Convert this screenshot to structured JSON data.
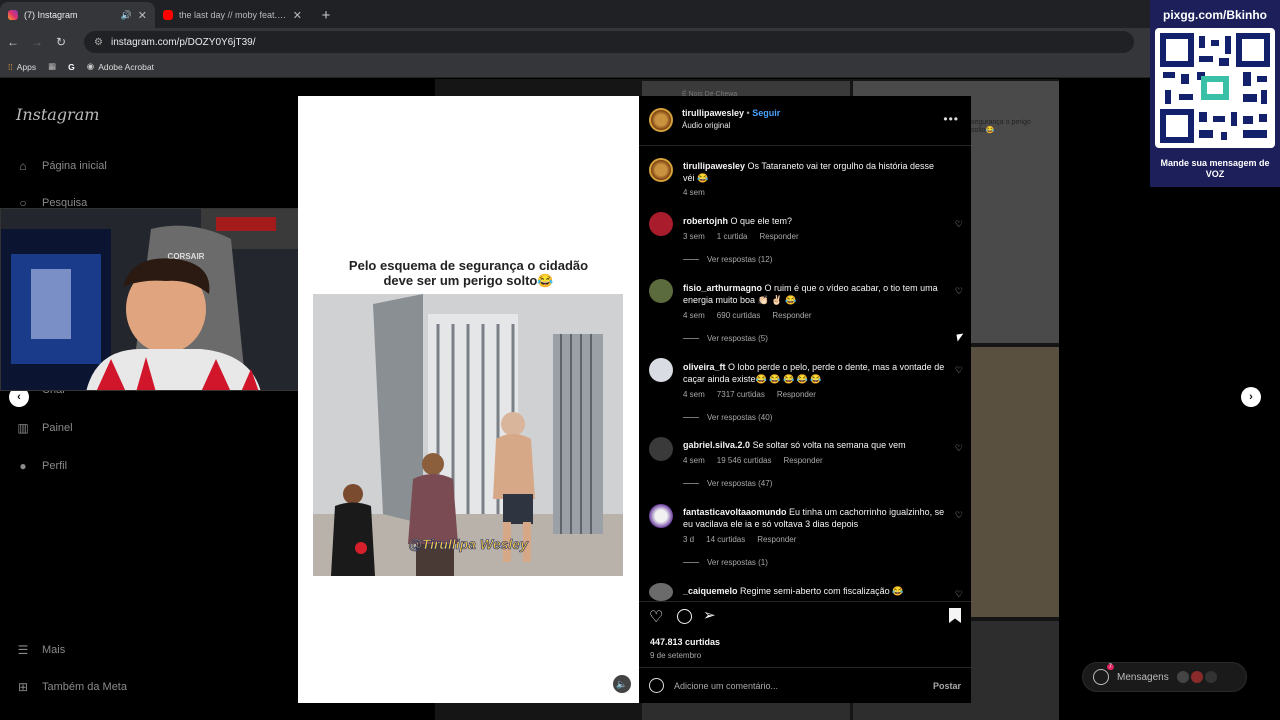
{
  "browser": {
    "tabs": [
      {
        "title": "(7) Instagram",
        "active": true,
        "favicon_color": "#e1306c"
      },
      {
        "title": "the last day // moby feat. skylar",
        "active": false,
        "favicon_color": "#ff0000"
      }
    ],
    "url": "instagram.com/p/DOZY0Y6jT39/",
    "bookmarks": [
      "Apps",
      "Adobe Acrobat"
    ]
  },
  "sidebar": {
    "logo": "Instagram",
    "items": [
      {
        "label": "Página inicial",
        "icon": "home-icon"
      },
      {
        "label": "Pesquisa",
        "icon": "search-icon"
      },
      {
        "label": "Criar",
        "icon": "create-icon"
      },
      {
        "label": "Painel",
        "icon": "dashboard-icon"
      },
      {
        "label": "Perfil",
        "icon": "profile-icon"
      },
      {
        "label": "Mais",
        "icon": "menu-icon"
      },
      {
        "label": "Também da Meta",
        "icon": "meta-icon"
      }
    ]
  },
  "webcam": {
    "chair_brand": "CORSAIR"
  },
  "video": {
    "caption": "Pelo esquema de segurança o cidadão deve ser um perigo solto😂",
    "watermark": "@Tirullipa Wesley"
  },
  "post": {
    "author": "tirullipawesley",
    "follow_label": "Seguir",
    "audio": "Áudio original",
    "caption": {
      "username": "tirullipawesley",
      "text": "Os Tataraneto vai ter orgulho da história desse véi 😂",
      "time": "4 sem"
    },
    "comments": [
      {
        "username": "robertojnh",
        "text": "O que ele tem?",
        "time": "3 sem",
        "likes": "1 curtida",
        "reply": "Responder",
        "replies": "Ver respostas (12)"
      },
      {
        "username": "fisio_arthurmagno",
        "text": "O ruim é que o vídeo acabar, o tio tem uma energia muito boa 👏🏻 ✌🏻 😂",
        "time": "4 sem",
        "likes": "690 curtidas",
        "reply": "Responder",
        "replies": "Ver respostas (5)"
      },
      {
        "username": "oliveira_ft",
        "text": "O lobo perde o pelo, perde o dente, mas a vontade de caçar ainda existe😂 😂 😂 😂 😂",
        "time": "4 sem",
        "likes": "7317 curtidas",
        "reply": "Responder",
        "replies": "Ver respostas (40)"
      },
      {
        "username": "gabriel.silva.2.0",
        "text": "Se soltar só volta na semana que vem",
        "time": "4 sem",
        "likes": "19 546 curtidas",
        "reply": "Responder",
        "replies": "Ver respostas (47)"
      },
      {
        "username": "fantasticavoltaaomundo",
        "text": "Eu tinha um cachorrinho igualzinho, se eu vacilava ele ia e só voltava 3 dias depois",
        "time": "3 d",
        "likes": "14 curtidas",
        "reply": "Responder",
        "replies": "Ver respostas (1)"
      },
      {
        "username": "_caiquemelo",
        "text": "Regime semi-aberto com fiscalização 😂",
        "time": "",
        "likes": "",
        "reply": "",
        "replies": ""
      }
    ],
    "likes_total": "447.813 curtidas",
    "date": "9 de setembro",
    "comment_placeholder": "Adicione um comentário...",
    "post_button": "Postar"
  },
  "overlay": {
    "qr_url": "pixgg.com/Bkinho",
    "qr_message": "Mande sua mensagem de VOZ"
  },
  "messages": {
    "label": "Mensagens",
    "badge": "7"
  },
  "bg_tile_text": "É Nois De Chewa",
  "bg_tile_text2": "segurança o perigo solto😂"
}
